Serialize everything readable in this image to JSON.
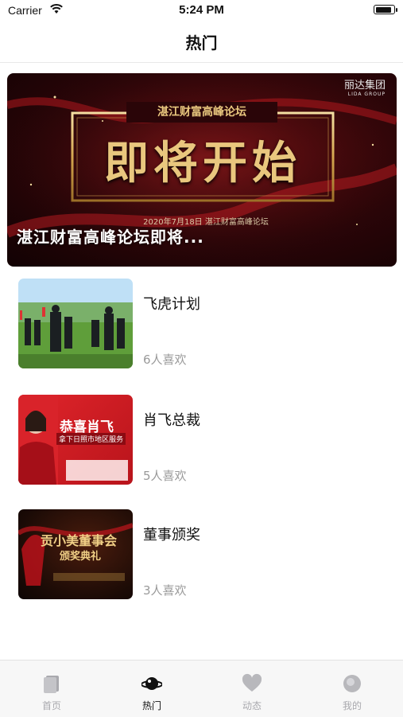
{
  "status_bar": {
    "carrier": "Carrier",
    "time": "5:24 PM"
  },
  "nav": {
    "title": "热门"
  },
  "banner": {
    "caption": "湛江财富高峰论坛即将...",
    "art_brand": "丽达集团",
    "art_brand_en": "LIDA GROUP",
    "art_subtitle": "湛江财富高峰论坛",
    "art_main": "即将开始",
    "art_date": "2020年7月18日  湛江财富高峰论坛"
  },
  "items": [
    {
      "title": "飞虎计划",
      "likes": "6人喜欢"
    },
    {
      "title": "肖飞总裁",
      "likes": "5人喜欢",
      "thumb_text": "恭喜肖飞",
      "thumb_sub": "拿下日照市地区服务"
    },
    {
      "title": "董事颁奖",
      "likes": "3人喜欢",
      "thumb_text": "贡小美董事会",
      "thumb_sub": "颁奖典礼"
    }
  ],
  "tabbar": {
    "tabs": [
      {
        "label": "首页",
        "icon": "book-icon"
      },
      {
        "label": "热门",
        "icon": "planet-icon"
      },
      {
        "label": "动态",
        "icon": "heart-icon"
      },
      {
        "label": "我的",
        "icon": "profile-icon"
      }
    ],
    "active_index": 1
  },
  "colors": {
    "accent": "#111111",
    "inactive": "#a9a9ae",
    "banner_red": "#5a0a0e",
    "gold": "#e2b86a"
  }
}
